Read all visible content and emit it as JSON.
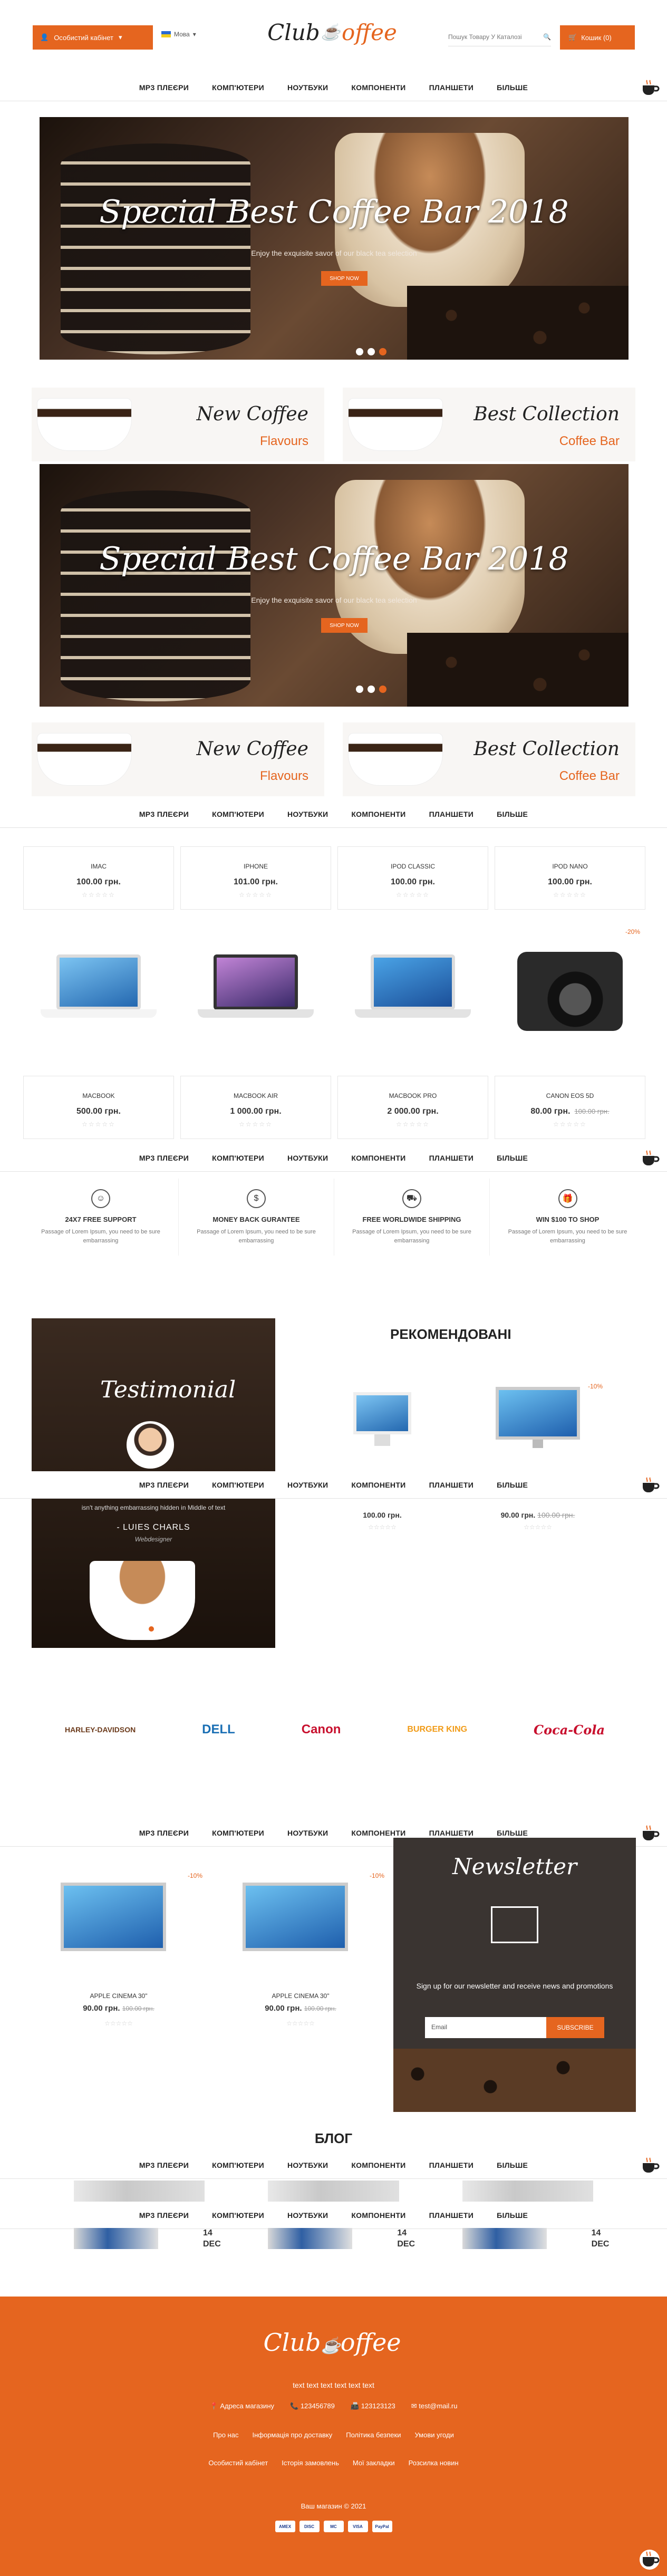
{
  "header": {
    "account_label": "Особистий кабінет",
    "language": "Мова",
    "logo_part1": "Club",
    "logo_part2": "offee",
    "search_placeholder": "Пошук Товару У Каталозі",
    "cart_label": "Кошик (0)"
  },
  "menu": [
    "МР3 ПЛЕЄРИ",
    "КОМП'ЮТЕРИ",
    "НОУТБУКИ",
    "КОМПОНЕНТИ",
    "ПЛАНШЕТИ",
    "БІЛЬШЕ"
  ],
  "hero": {
    "title": "Special  Best Coffee Bar 2018",
    "subtitle": "Enjoy the exquisite savor of our black tea selection",
    "button": "SHOP NOW"
  },
  "banners": [
    {
      "title": "New Coffee",
      "subtitle": "Flavours"
    },
    {
      "title": "Best Collection",
      "subtitle": "Coffee Bar"
    }
  ],
  "products_row1": [
    {
      "name": "IMAC",
      "price": "100.00 грн.",
      "old": ""
    },
    {
      "name": "IPHONE",
      "price": "101.00 грн.",
      "old": ""
    },
    {
      "name": "IPOD CLASSIC",
      "price": "100.00 грн.",
      "old": ""
    },
    {
      "name": "IPOD NANO",
      "price": "100.00 грн.",
      "old": ""
    }
  ],
  "products_row2": [
    {
      "name": "MACBOOK",
      "price": "500.00 грн.",
      "old": ""
    },
    {
      "name": "MACBOOK AIR",
      "price": "1 000.00 грн.",
      "old": ""
    },
    {
      "name": "MACBOOK PRO",
      "price": "2 000.00 грн.",
      "old": ""
    },
    {
      "name": "CANON EOS 5D",
      "price": "80.00 грн.",
      "old": "100.00 грн."
    }
  ],
  "sale_badge": "-20%",
  "features": [
    {
      "icon": "☺",
      "title": "24X7 FREE SUPPORT",
      "desc": "Passage of Lorem Ipsum, you need to be sure embarrassing"
    },
    {
      "icon": "$",
      "title": "MONEY BACK GURANTEE",
      "desc": "Passage of Lorem Ipsum, you need to be sure embarrassing"
    },
    {
      "icon": "⛟",
      "title": "FREE WORLDWIDE SHIPPING",
      "desc": "Passage of Lorem Ipsum, you need to be sure embarrassing"
    },
    {
      "icon": "🎁",
      "title": "WIN $100 TO SHOP",
      "desc": "Passage of Lorem Ipsum, you need to be sure embarrassing"
    }
  ],
  "testimonial": {
    "heading": "Testimonial",
    "quote": "isn't anything embarrassing hidden in Middle of text",
    "author": "- LUIES CHARLS",
    "role": "Webdesigner"
  },
  "recommended": {
    "title": "РЕКОМЕНДОВАНІ",
    "sale_badge": "-10%",
    "prices": [
      {
        "price": "100.00 грн.",
        "old": ""
      },
      {
        "price": "90.00 грн.",
        "old": "100.00 грн."
      }
    ]
  },
  "brands": [
    "HARLEY-DAVIDSON",
    "DELL",
    "Canon",
    "BURGER KING",
    "Coca-Cola"
  ],
  "cinema_products": [
    {
      "name": "APPLE CINEMA 30\"",
      "price": "90.00 грн.",
      "old": "100.00 грн.",
      "badge": "-10%"
    },
    {
      "name": "APPLE CINEMA 30\"",
      "price": "90.00 грн.",
      "old": "100.00 грн.",
      "badge": "-10%"
    }
  ],
  "newsletter": {
    "title": "Newsletter",
    "text": "Sign up for our newsletter and receive news and promotions",
    "placeholder": "Email",
    "button": "SUBSCRIBE"
  },
  "blog": {
    "title": "БЛОГ",
    "posts": [
      {
        "day": "14",
        "month": "DEC"
      },
      {
        "day": "14",
        "month": "DEC"
      },
      {
        "day": "14",
        "month": "DEC"
      }
    ]
  },
  "footer": {
    "tagline": "text text text text text text",
    "address": "Адреса магазину",
    "phone": "123456789",
    "fax": "123123123",
    "email": "test@mail.ru",
    "links1": [
      "Про нас",
      "Інформація про доставку",
      "Політика безпеки",
      "Умови угоди"
    ],
    "links2": [
      "Особистий кабінет",
      "Історія замовлень",
      "Мої закладки",
      "Розсилка новин"
    ],
    "copyright": "Ваш магазин © 2021",
    "payments": [
      "AMEX",
      "DISC",
      "MC",
      "VISA",
      "PayPal"
    ]
  },
  "colors": {
    "accent": "#e5651f"
  }
}
